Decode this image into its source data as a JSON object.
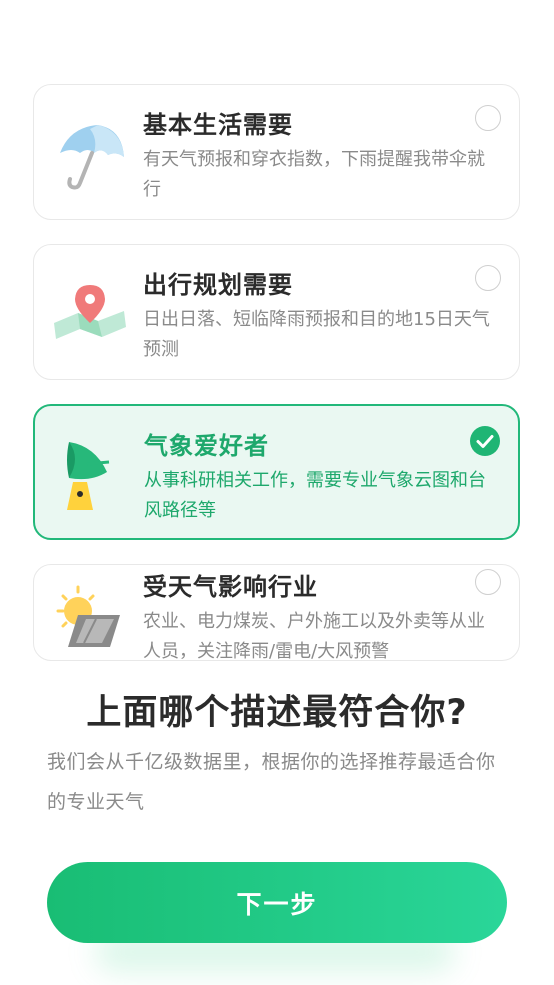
{
  "options": [
    {
      "title": "基本生活需要",
      "desc": "有天气预报和穿衣指数，下雨提醒我带伞就行",
      "icon": "umbrella-icon",
      "selected": false
    },
    {
      "title": "出行规划需要",
      "desc": "日出日落、短临降雨预报和目的地15日天气预测",
      "icon": "map-pin-icon",
      "selected": false
    },
    {
      "title": "气象爱好者",
      "desc": "从事科研相关工作，需要专业气象云图和台风路径等",
      "icon": "satellite-dish-icon",
      "selected": true
    },
    {
      "title": "受天气影响行业",
      "desc": "农业、电力煤炭、户外施工以及外卖等从业人员，关注降雨/雷电/大风预警",
      "icon": "sun-solar-panel-icon",
      "selected": false
    }
  ],
  "question": "上面哪个描述最符合你?",
  "subtitle": "我们会从千亿级数据里，根据你的选择推荐最适合你的专业天气",
  "next_button": "下一步",
  "colors": {
    "accent": "#1fb574",
    "selected_bg": "#eaf8f2",
    "title": "#2b2b2b",
    "desc": "#8a8a8a"
  }
}
